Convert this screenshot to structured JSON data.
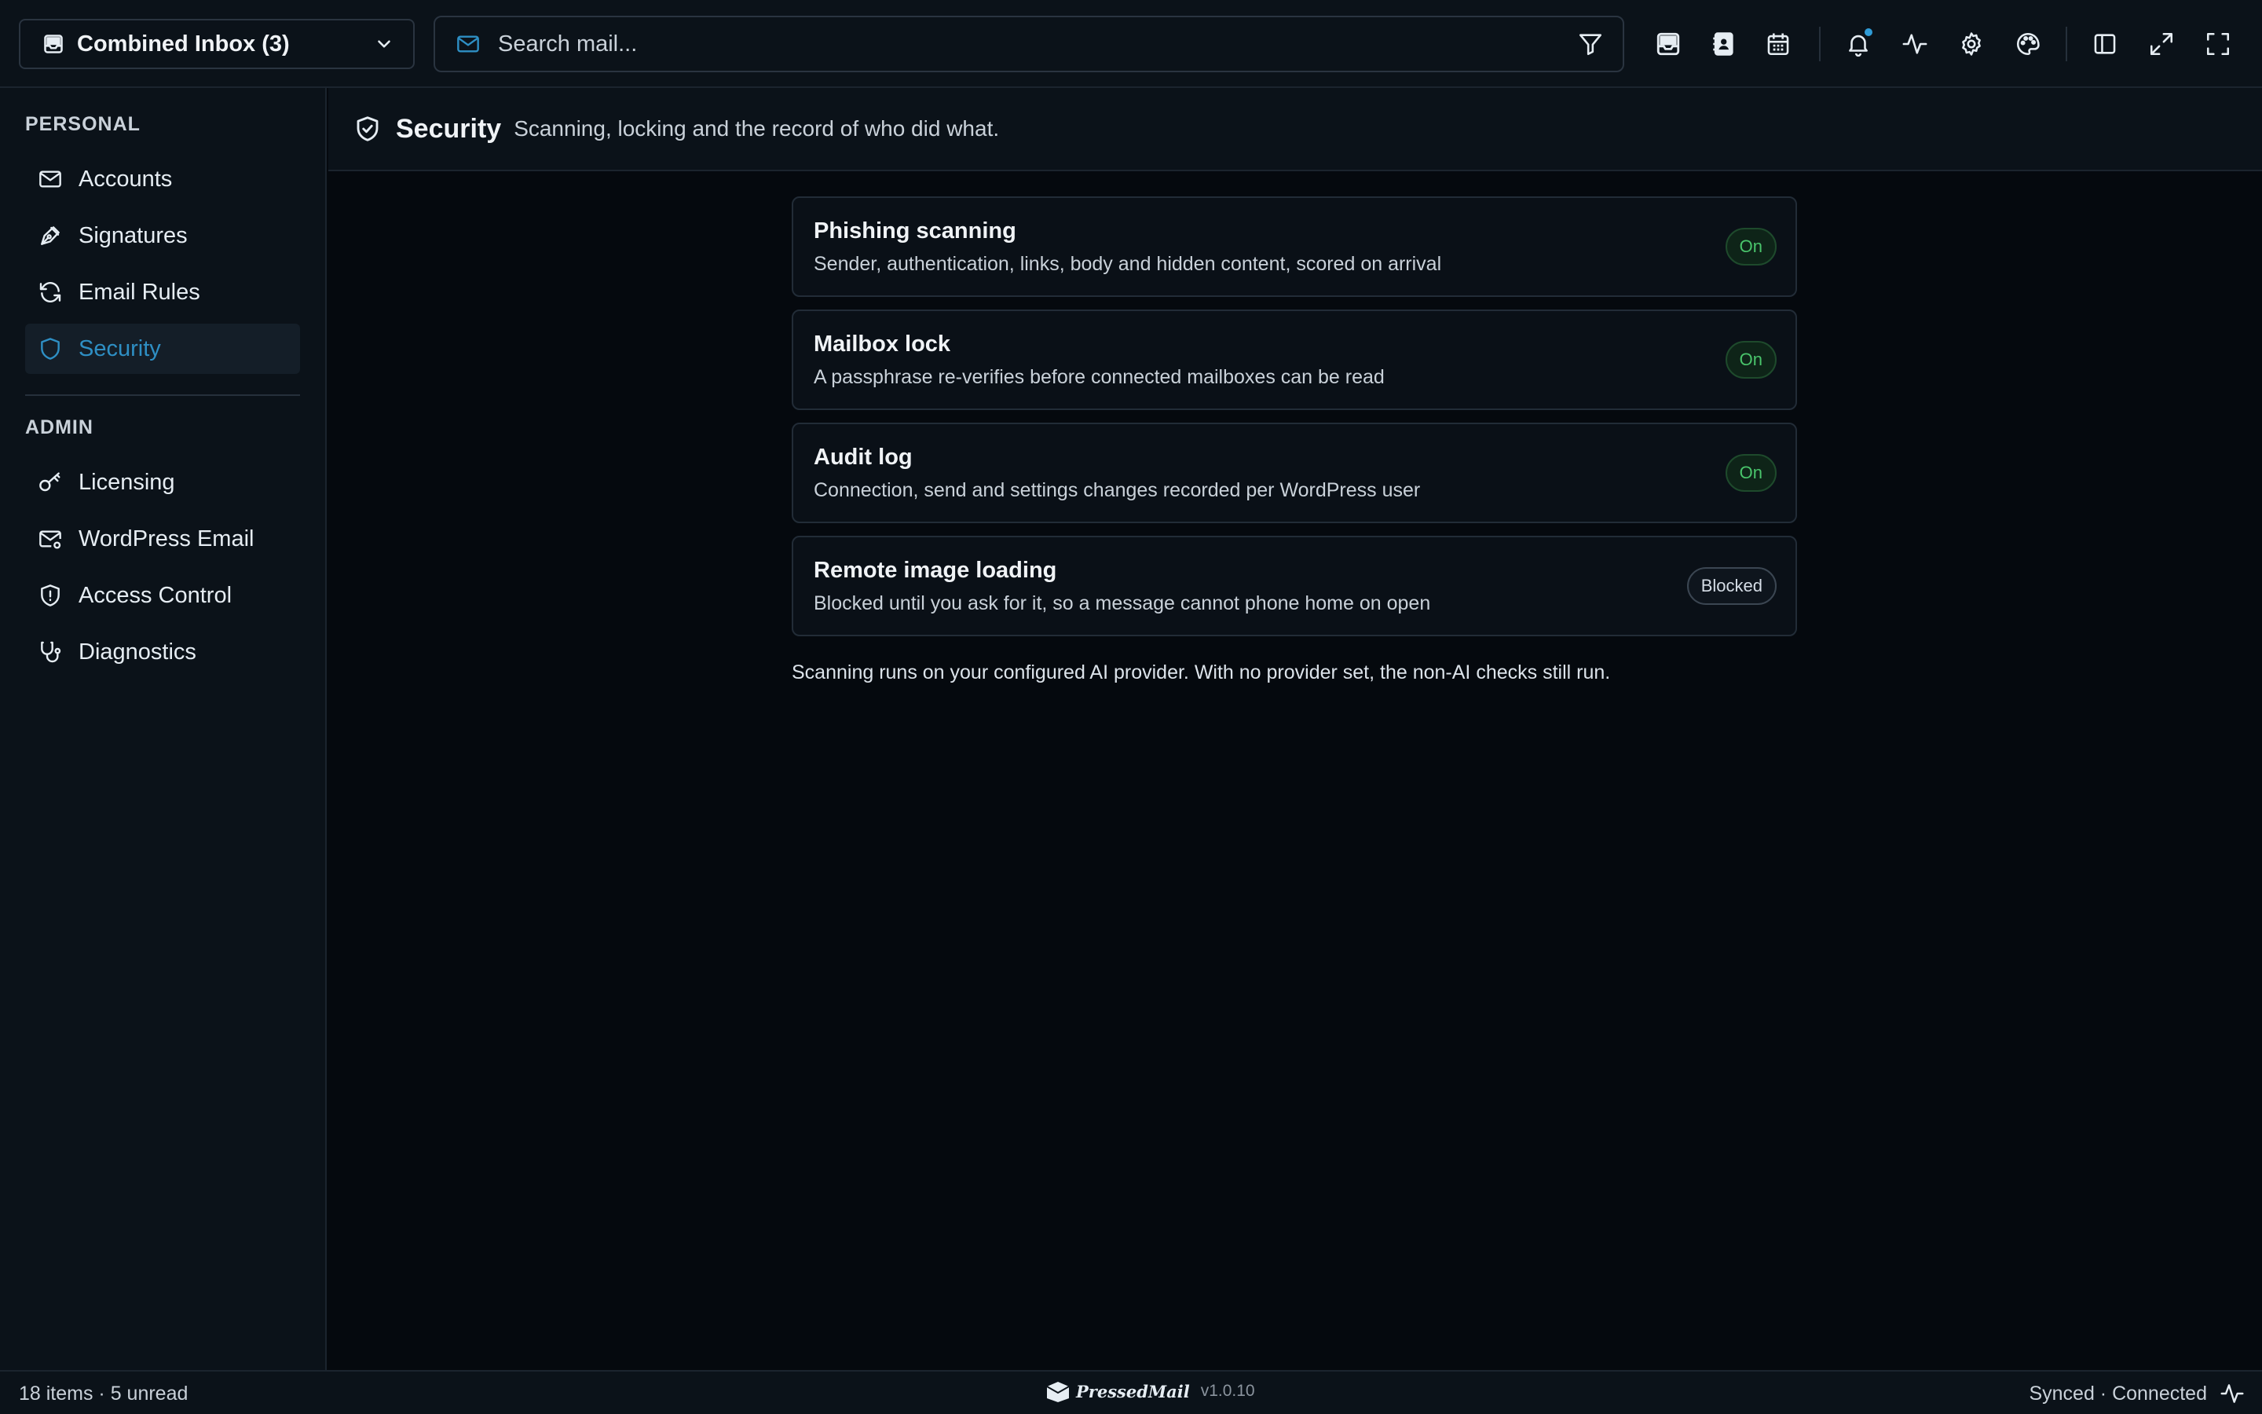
{
  "topbar": {
    "inbox_selector": "Combined Inbox (3)",
    "search_placeholder": "Search mail..."
  },
  "sidebar": {
    "personal_label": "PERSONAL",
    "personal_items": [
      {
        "label": "Accounts",
        "icon": "mail-icon"
      },
      {
        "label": "Signatures",
        "icon": "pen-icon"
      },
      {
        "label": "Email Rules",
        "icon": "refresh-icon"
      },
      {
        "label": "Security",
        "icon": "shield-icon",
        "active": true
      }
    ],
    "admin_label": "ADMIN",
    "admin_items": [
      {
        "label": "Licensing",
        "icon": "key-icon"
      },
      {
        "label": "WordPress Email",
        "icon": "mail-settings-icon"
      },
      {
        "label": "Access Control",
        "icon": "shield-alert-icon"
      },
      {
        "label": "Diagnostics",
        "icon": "stethoscope-icon"
      }
    ]
  },
  "page": {
    "title": "Security",
    "subtitle": "Scanning, locking and the record of who did what."
  },
  "cards": [
    {
      "title": "Phishing scanning",
      "desc": "Sender, authentication, links, body and hidden content, scored on arrival",
      "status": "On"
    },
    {
      "title": "Mailbox lock",
      "desc": "A passphrase re-verifies before connected mailboxes can be read",
      "status": "On"
    },
    {
      "title": "Audit log",
      "desc": "Connection, send and settings changes recorded per WordPress user",
      "status": "On"
    },
    {
      "title": "Remote image loading",
      "desc": "Blocked until you ask for it, so a message cannot phone home on open",
      "status": "Blocked"
    }
  ],
  "footnote": "Scanning runs on your configured AI provider. With no provider set, the non-AI checks still run.",
  "status": {
    "left": "18 items · 5 unread",
    "brand": "PressedMail",
    "version": "v1.0.10",
    "right": "Synced · Connected"
  },
  "colors": {
    "accent": "#2e8fc4",
    "on_badge": "#49c46b",
    "background": "#05090e"
  }
}
